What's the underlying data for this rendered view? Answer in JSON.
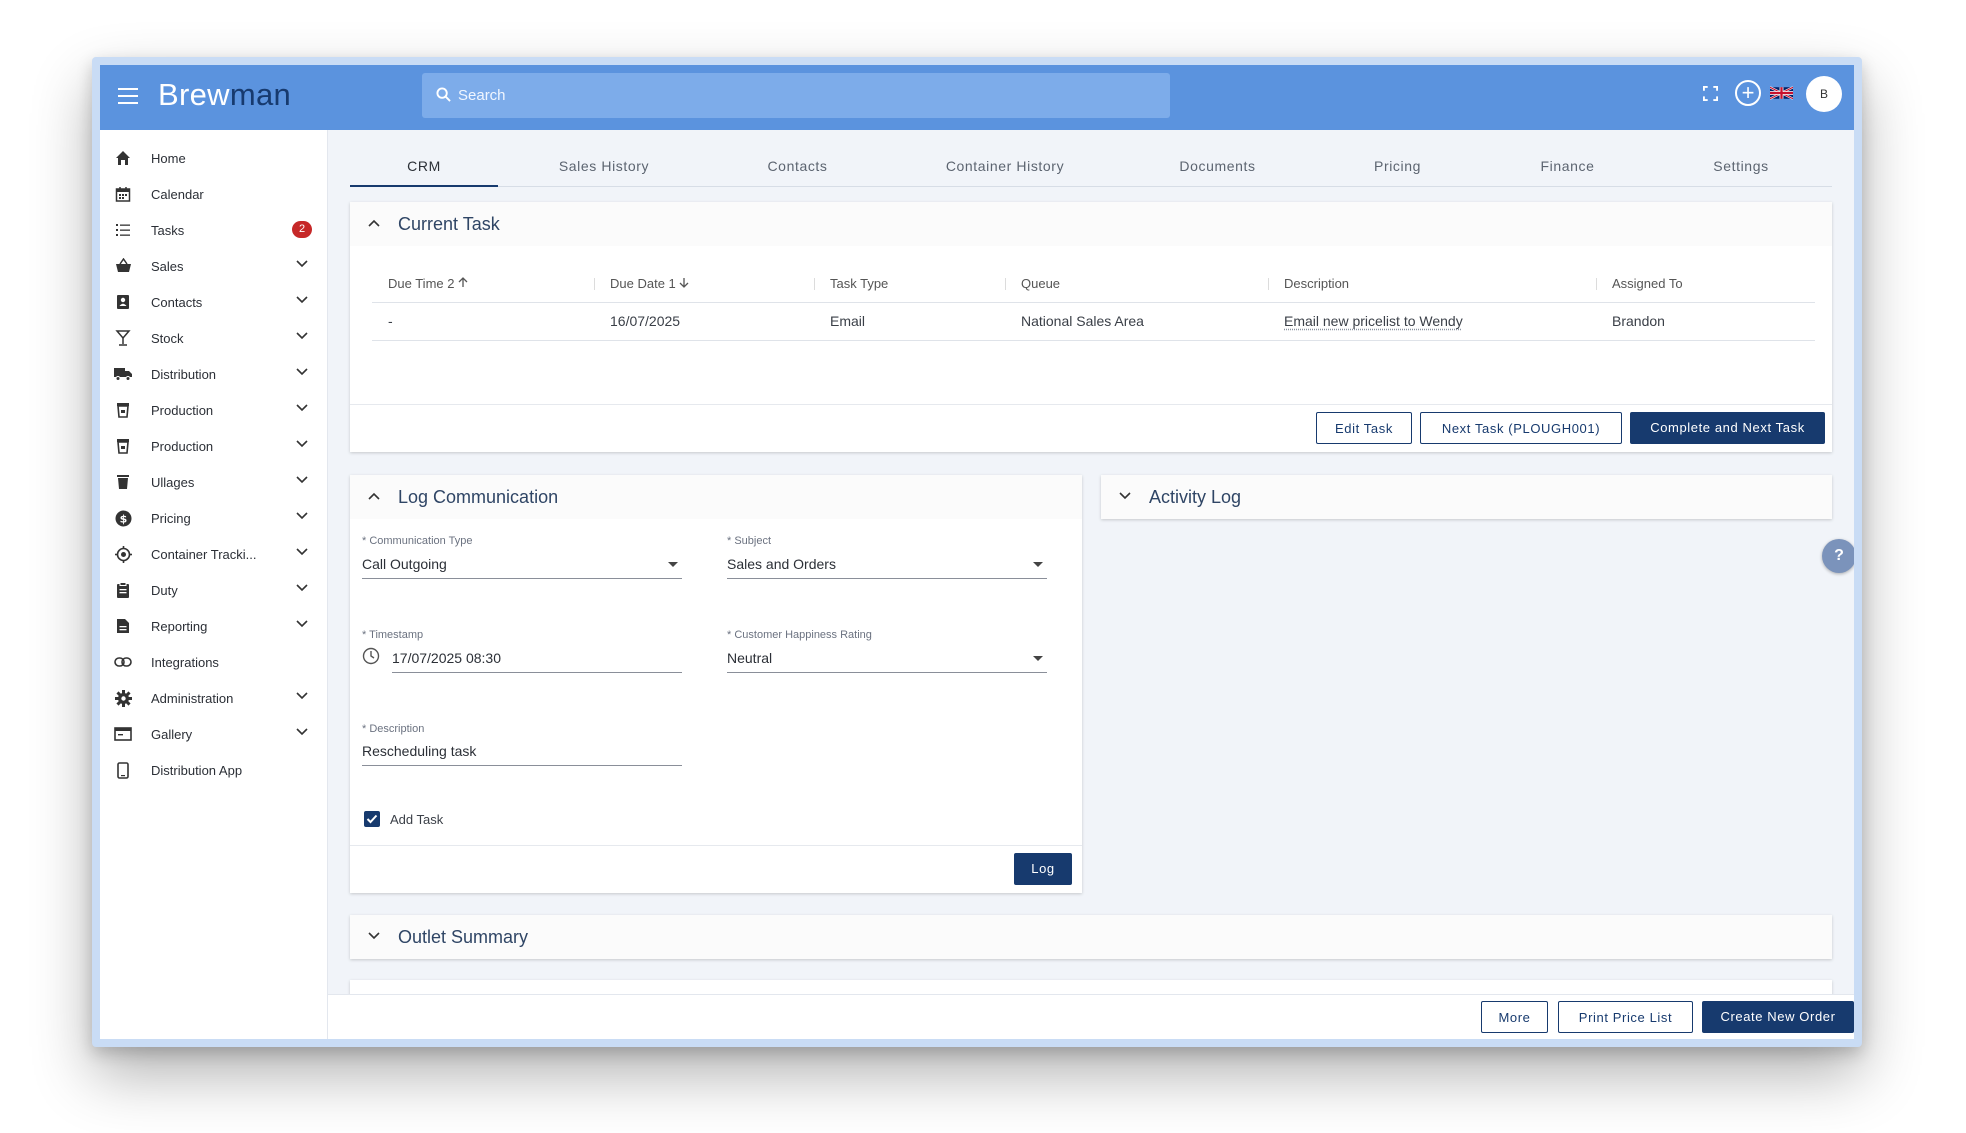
{
  "app": {
    "logo_part1": "Brew",
    "logo_part2": "man",
    "search_placeholder": "Search",
    "avatar_initial": "B",
    "accent_color": "#173a6e",
    "topbar_color": "#5b93de"
  },
  "sidebar": {
    "items": [
      {
        "label": "Home",
        "icon": "home-icon"
      },
      {
        "label": "Calendar",
        "icon": "calendar-icon"
      },
      {
        "label": "Tasks",
        "icon": "list-icon",
        "badge": "2"
      },
      {
        "label": "Sales",
        "icon": "basket-icon"
      },
      {
        "label": "Contacts",
        "icon": "contacts-icon"
      },
      {
        "label": "Stock",
        "icon": "glass-icon"
      },
      {
        "label": "Distribution",
        "icon": "truck-icon"
      },
      {
        "label": "Production",
        "icon": "production-icon"
      },
      {
        "label": "Production",
        "icon": "production-icon"
      },
      {
        "label": "Ullages",
        "icon": "bin-icon"
      },
      {
        "label": "Pricing",
        "icon": "dollar-icon"
      },
      {
        "label": "Container Tracki...",
        "icon": "target-icon"
      },
      {
        "label": "Duty",
        "icon": "clipboard-icon"
      },
      {
        "label": "Reporting",
        "icon": "report-icon"
      },
      {
        "label": "Integrations",
        "icon": "link-icon"
      },
      {
        "label": "Administration",
        "icon": "gear-icon"
      },
      {
        "label": "Gallery",
        "icon": "gallery-icon"
      },
      {
        "label": "Distribution App",
        "icon": "phone-icon"
      }
    ]
  },
  "tabs": [
    "CRM",
    "Sales History",
    "Contacts",
    "Container History",
    "Documents",
    "Pricing",
    "Finance",
    "Settings"
  ],
  "current_task": {
    "title": "Current Task",
    "columns": [
      "Due Time 2",
      "Due Date 1",
      "Task Type",
      "Queue",
      "Description",
      "Assigned To"
    ],
    "rows": [
      [
        "-",
        "16/07/2025",
        "Email",
        "National Sales Area",
        "Email new pricelist to Wendy",
        "Brandon"
      ]
    ],
    "buttons": {
      "edit": "Edit Task",
      "next": "Next Task (PLOUGH001)",
      "complete": "Complete and Next Task"
    }
  },
  "log_communication": {
    "title": "Log Communication",
    "communication_type_label": "* Communication Type",
    "communication_type_value": "Call Outgoing",
    "subject_label": "* Subject",
    "subject_value": "Sales and Orders",
    "timestamp_label": "* Timestamp",
    "timestamp_value": "17/07/2025 08:30",
    "happiness_label": "* Customer Happiness Rating",
    "happiness_value": "Neutral",
    "description_label": "* Description",
    "description_value": "Rescheduling task",
    "add_task_label": "Add Task",
    "add_task_checked": true,
    "log_button": "Log"
  },
  "activity_log": {
    "title": "Activity Log"
  },
  "outlet_summary": {
    "title": "Outlet Summary"
  },
  "footer": {
    "more": "More",
    "print_price_list": "Print Price List",
    "create_new_order": "Create New Order"
  },
  "help_glyph": "?"
}
